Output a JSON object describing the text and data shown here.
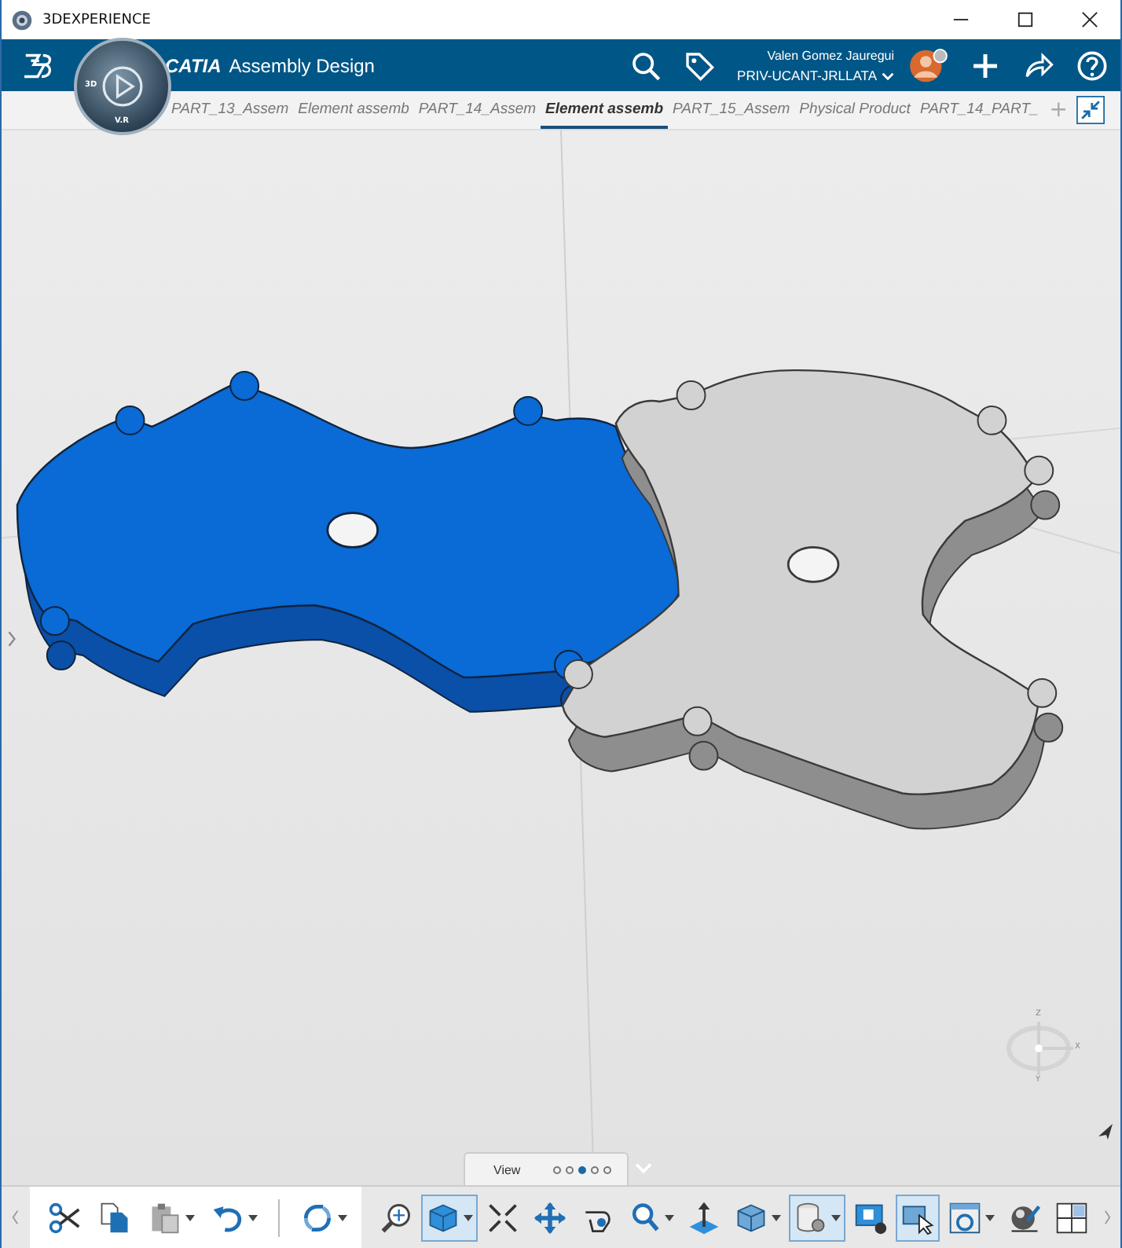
{
  "window": {
    "title": "3DEXPERIENCE"
  },
  "header": {
    "brand": "CATIA",
    "app": "Assembly Design",
    "user": "Valen Gomez Jauregui",
    "tenant": "PRIV-UCANT-JRLLATA",
    "compass_labels": [
      "3D",
      "V.R"
    ]
  },
  "tabs": [
    {
      "label": "PART_13_Assem",
      "selected": false
    },
    {
      "label": "Element assemb",
      "selected": false
    },
    {
      "label": "PART_14_Assem",
      "selected": false
    },
    {
      "label": "Element assemb",
      "selected": true
    },
    {
      "label": "PART_15_Assem",
      "selected": false
    },
    {
      "label": "Physical Product",
      "selected": false
    },
    {
      "label": "PART_14_PART_",
      "selected": false
    }
  ],
  "add_tab": "+",
  "viewport": {
    "parts": [
      {
        "kind": "blue-part"
      },
      {
        "kind": "grey-part"
      }
    ],
    "compass_axes": [
      "Z",
      "X",
      "Y"
    ]
  },
  "view_bar": {
    "label": "View",
    "pages": [
      {
        "selected": false
      },
      {
        "selected": false
      },
      {
        "selected": true
      },
      {
        "selected": false
      },
      {
        "selected": false
      }
    ]
  },
  "toolbar": {
    "edit_tools": [
      {
        "kind": "cut",
        "selected": false,
        "dropdown": false
      },
      {
        "kind": "copy",
        "selected": false,
        "dropdown": false
      },
      {
        "kind": "paste",
        "selected": false,
        "dropdown": true
      },
      {
        "kind": "undo",
        "selected": false,
        "dropdown": true
      },
      {
        "kind": "refresh",
        "selected": false,
        "dropdown": true
      }
    ],
    "view_tools": [
      {
        "kind": "zoom-area",
        "selected": false,
        "dropdown": false
      },
      {
        "kind": "iso-view",
        "selected": true,
        "dropdown": true
      },
      {
        "kind": "fit-all",
        "selected": false,
        "dropdown": false
      },
      {
        "kind": "pan",
        "selected": false,
        "dropdown": false
      },
      {
        "kind": "rotate",
        "selected": false,
        "dropdown": false
      },
      {
        "kind": "zoom",
        "selected": false,
        "dropdown": true
      },
      {
        "kind": "normal-view",
        "selected": false,
        "dropdown": false
      },
      {
        "kind": "render-style",
        "selected": false,
        "dropdown": true
      },
      {
        "kind": "cache",
        "selected": true,
        "dropdown": true
      },
      {
        "kind": "screen-settings",
        "selected": false,
        "dropdown": false
      },
      {
        "kind": "select",
        "selected": true,
        "dropdown": false
      },
      {
        "kind": "timer-refresh",
        "selected": false,
        "dropdown": true
      },
      {
        "kind": "material",
        "selected": false,
        "dropdown": false
      },
      {
        "kind": "layout",
        "selected": false,
        "dropdown": false
      }
    ]
  }
}
